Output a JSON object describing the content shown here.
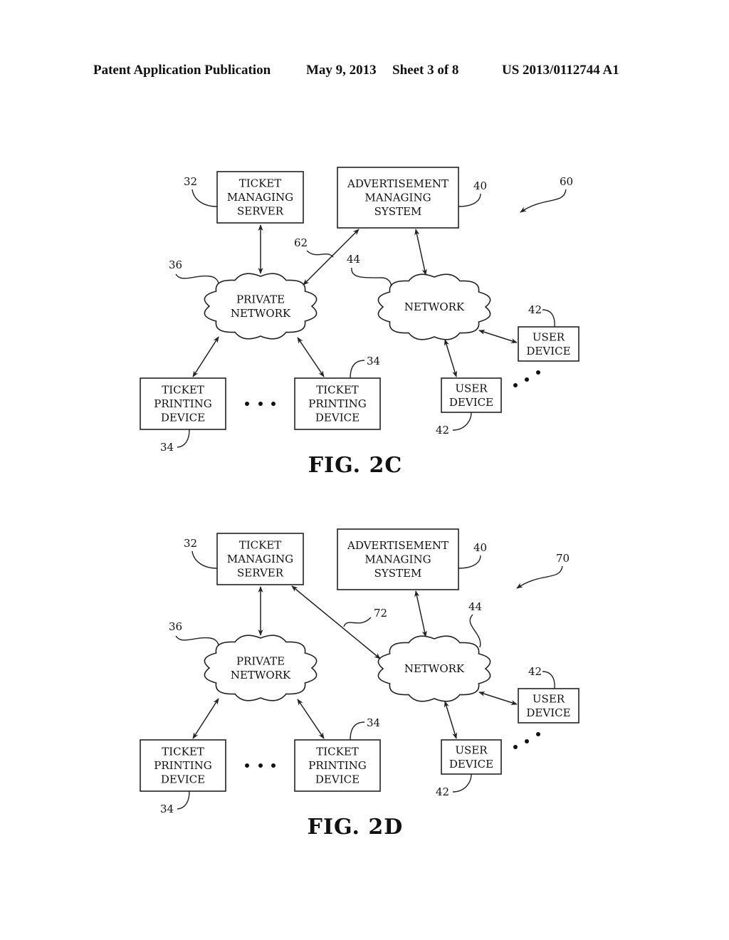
{
  "header": {
    "left": "Patent Application Publication",
    "date": "May 9, 2013",
    "sheet": "Sheet 3 of 8",
    "number": "US 2013/0112744 A1"
  },
  "figures": [
    {
      "id": "2C",
      "caption": "FIG. 2C",
      "system_ref": "60",
      "link_ref": "62",
      "link": "private-network-to-advertisement-managing-system",
      "nodes": {
        "ticket_managing_server": {
          "lines": [
            "TICKET",
            "MANAGING",
            "SERVER"
          ],
          "ref": "32"
        },
        "advertisement_managing_system": {
          "lines": [
            "ADVERTISEMENT",
            "MANAGING",
            "SYSTEM"
          ],
          "ref": "40"
        },
        "private_network": {
          "lines": [
            "PRIVATE",
            "NETWORK"
          ],
          "ref": "36"
        },
        "network": {
          "lines": [
            "NETWORK"
          ],
          "ref": "44"
        },
        "ticket_printing_device_1": {
          "lines": [
            "TICKET",
            "PRINTING",
            "DEVICE"
          ],
          "ref": "34"
        },
        "ticket_printing_device_2": {
          "lines": [
            "TICKET",
            "PRINTING",
            "DEVICE"
          ],
          "ref": "34"
        },
        "user_device_1": {
          "lines": [
            "USER",
            "DEVICE"
          ],
          "ref": "42"
        },
        "user_device_2": {
          "lines": [
            "USER",
            "DEVICE"
          ],
          "ref": "42"
        }
      }
    },
    {
      "id": "2D",
      "caption": "FIG. 2D",
      "system_ref": "70",
      "link_ref": "72",
      "link": "ticket-managing-server-to-network",
      "nodes": {
        "ticket_managing_server": {
          "lines": [
            "TICKET",
            "MANAGING",
            "SERVER"
          ],
          "ref": "32"
        },
        "advertisement_managing_system": {
          "lines": [
            "ADVERTISEMENT",
            "MANAGING",
            "SYSTEM"
          ],
          "ref": "40"
        },
        "private_network": {
          "lines": [
            "PRIVATE",
            "NETWORK"
          ],
          "ref": "36"
        },
        "network": {
          "lines": [
            "NETWORK"
          ],
          "ref": "44"
        },
        "ticket_printing_device_1": {
          "lines": [
            "TICKET",
            "PRINTING",
            "DEVICE"
          ],
          "ref": "34"
        },
        "ticket_printing_device_2": {
          "lines": [
            "TICKET",
            "PRINTING",
            "DEVICE"
          ],
          "ref": "34"
        },
        "user_device_1": {
          "lines": [
            "USER",
            "DEVICE"
          ],
          "ref": "42"
        },
        "user_device_2": {
          "lines": [
            "USER",
            "DEVICE"
          ],
          "ref": "42"
        }
      }
    }
  ]
}
